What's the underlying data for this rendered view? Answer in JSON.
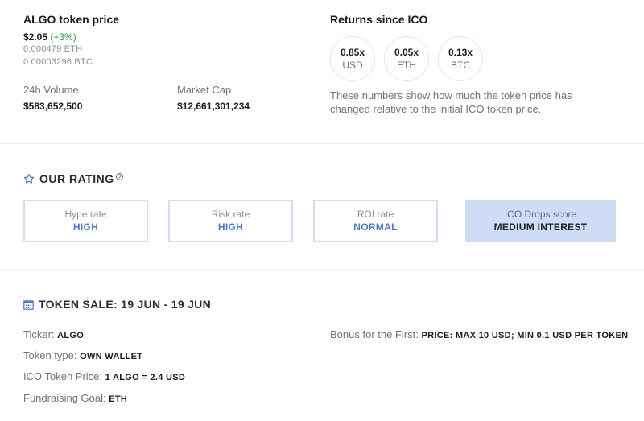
{
  "price": {
    "title": "ALGO token price",
    "usd": "$2.05",
    "change": "(+3%)",
    "eth": "0.000479 ETH",
    "btc": "0.00003296 BTC",
    "volume_label": "24h Volume",
    "volume_value": "$583,652,500",
    "marketcap_label": "Market Cap",
    "marketcap_value": "$12,661,301,234"
  },
  "returns": {
    "title": "Returns since ICO",
    "items": [
      {
        "value": "0.85x",
        "currency": "USD"
      },
      {
        "value": "0.05x",
        "currency": "ETH"
      },
      {
        "value": "0.13x",
        "currency": "BTC"
      }
    ],
    "note": "These numbers show how much the token price has changed relative to the initial ICO token price."
  },
  "rating": {
    "title": "OUR RATING",
    "help": "?",
    "cards": [
      {
        "label": "Hype rate",
        "value": "HIGH"
      },
      {
        "label": "Risk rate",
        "value": "HIGH"
      },
      {
        "label": "ROI rate",
        "value": "NORMAL"
      },
      {
        "label": "ICO Drops score",
        "value": "MEDIUM INTEREST"
      }
    ]
  },
  "sale": {
    "title": "TOKEN SALE: 19 JUN - 19 JUN",
    "ticker_label": "Ticker:",
    "ticker_value": "ALGO",
    "type_label": "Token type:",
    "type_value": "OWN WALLET",
    "price_label": "ICO Token Price:",
    "price_value": "1 ALGO = 2.4 USD",
    "goal_label": "Fundraising Goal:",
    "goal_value": "ETH",
    "bonus_label": "Bonus for the First:",
    "bonus_value": "PRICE: MAX 10 USD; MIN 0.1 USD PER TOKEN"
  },
  "colors": {
    "accent": "#4f78c8",
    "score_bg": "#cfdcf6",
    "positive": "#2f9e44"
  }
}
